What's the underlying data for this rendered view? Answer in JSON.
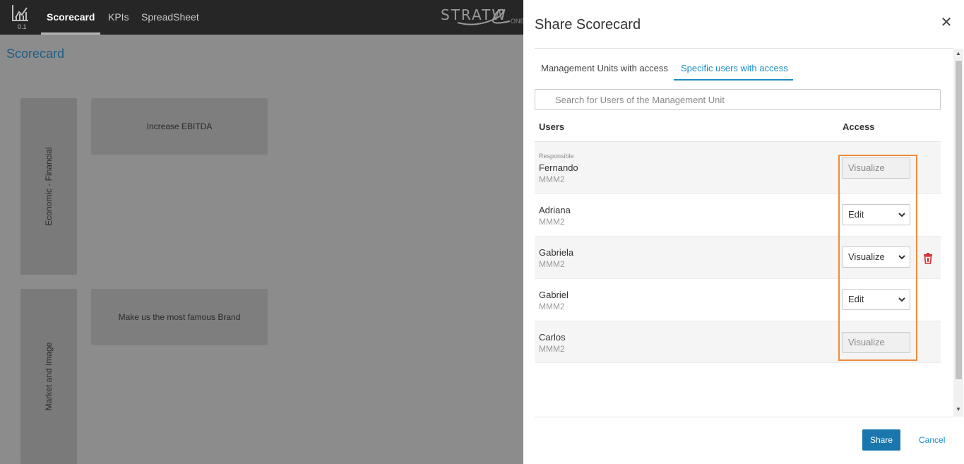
{
  "app": {
    "version": "0.1",
    "nav": [
      "Scorecard",
      "KPIs",
      "SpreadSheet"
    ],
    "brand": "STRATW",
    "brand_sub": "ONE",
    "page_title": "Scorecard",
    "perspectives": [
      "Economic - Financial",
      "Market and Image"
    ],
    "objectives": [
      "Increase EBITDA",
      "Make us the most famous Brand"
    ]
  },
  "modal": {
    "title": "Share Scorecard",
    "close_icon": "close-icon",
    "tabs": [
      "Management Units with access",
      "Specific users with access"
    ],
    "active_tab": "Specific users with access",
    "search_placeholder": "Search for Users of the Management Unit",
    "columns": {
      "users": "Users",
      "access": "Access"
    },
    "rows": [
      {
        "role": "Responsible",
        "name": "Fernando",
        "unit": "MMM2",
        "access": "Visualize",
        "editable": false
      },
      {
        "role": "",
        "name": "Adriana",
        "unit": "MMM2",
        "access": "Edit",
        "editable": true
      },
      {
        "role": "",
        "name": "Gabriela",
        "unit": "MMM2",
        "access": "Visualize",
        "editable": true,
        "deletable": true
      },
      {
        "role": "",
        "name": "Gabriel",
        "unit": "MMM2",
        "access": "Edit",
        "editable": true
      },
      {
        "role": "",
        "name": "Carlos",
        "unit": "MMM2",
        "access": "Visualize",
        "editable": false
      }
    ],
    "buttons": {
      "share": "Share",
      "cancel": "Cancel"
    }
  },
  "colors": {
    "accent": "#1a8cc7",
    "primary_button": "#1a77ad",
    "highlight": "#ef8a3c",
    "delete_icon": "#d32f2f"
  }
}
